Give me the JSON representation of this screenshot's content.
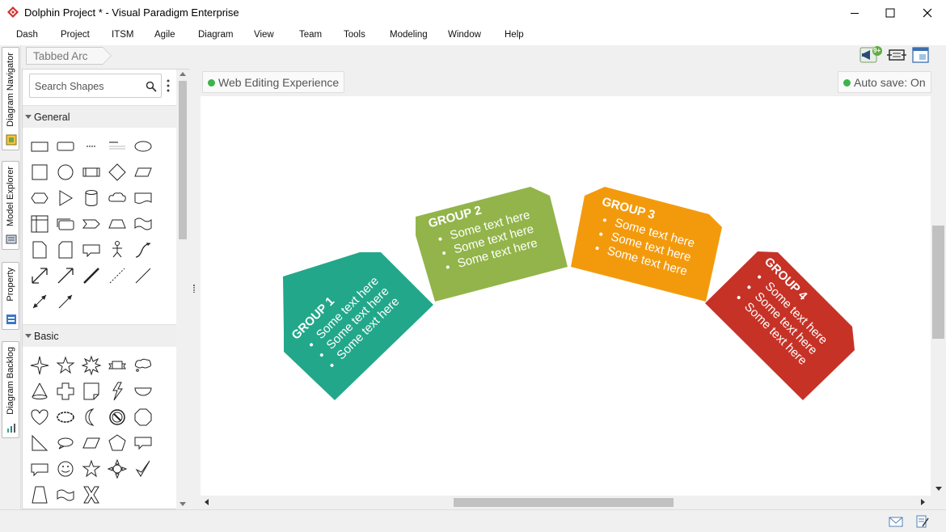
{
  "window": {
    "title": "Dolphin Project * - Visual Paradigm Enterprise"
  },
  "menu": [
    "Dash",
    "Project",
    "ITSM",
    "Agile",
    "Diagram",
    "View",
    "Team",
    "Tools",
    "Modeling",
    "Window",
    "Help"
  ],
  "side_tabs": [
    "Diagram Navigator",
    "Model Explorer",
    "Property",
    "Diagram Backlog"
  ],
  "breadcrumb": {
    "current": "Tabbed Arc"
  },
  "notification_badge": "9+",
  "shapes_panel": {
    "search_placeholder": "Search Shapes",
    "sections": [
      "General",
      "Basic"
    ]
  },
  "canvas": {
    "mode_label": "Web Editing Experience",
    "autosave_label": "Auto save: On",
    "status_dot_color": "#3cb44b"
  },
  "groups": [
    {
      "title": "GROUP 1",
      "items": [
        "Some text here",
        "Some text here",
        "Some text here"
      ],
      "color": "#22a78a"
    },
    {
      "title": "GROUP 2",
      "items": [
        "Some text here",
        "Some text here",
        "Some text here"
      ],
      "color": "#92b44a"
    },
    {
      "title": "GROUP 3",
      "items": [
        "Some text here",
        "Some text here",
        "Some text here"
      ],
      "color": "#f39a0c"
    },
    {
      "title": "GROUP 4",
      "items": [
        "Some text here",
        "Some text here",
        "Some text here"
      ],
      "color": "#c73226"
    }
  ]
}
